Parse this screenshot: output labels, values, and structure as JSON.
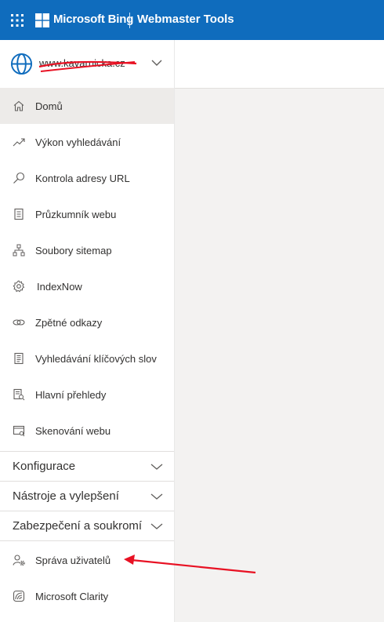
{
  "header": {
    "brand": "Microsoft Bing",
    "product": "Webmaster Tools"
  },
  "site": {
    "url": "www.kavarnicka.cz"
  },
  "nav": {
    "items": [
      {
        "label": "Domů",
        "icon": "home-icon"
      },
      {
        "label": "Výkon vyhledávání",
        "icon": "trend-icon"
      },
      {
        "label": "Kontrola adresy URL",
        "icon": "search-icon"
      },
      {
        "label": "Průzkumník webu",
        "icon": "document-icon"
      },
      {
        "label": "Soubory sitemap",
        "icon": "sitemap-icon"
      },
      {
        "label": "IndexNow",
        "icon": "gear-icon"
      },
      {
        "label": "Zpětné odkazy",
        "icon": "link-icon"
      },
      {
        "label": "Vyhledávání klíčových slov",
        "icon": "list-icon"
      },
      {
        "label": "Hlavní přehledy",
        "icon": "report-icon"
      },
      {
        "label": "Skenování webu",
        "icon": "scan-icon"
      }
    ],
    "sections": [
      {
        "label": "Konfigurace"
      },
      {
        "label": "Nástroje a vylepšení"
      },
      {
        "label": "Zabezpečení a soukromí"
      }
    ],
    "bottom": [
      {
        "label": "Správa uživatelů",
        "icon": "user-settings-icon"
      },
      {
        "label": "Microsoft Clarity",
        "icon": "clarity-icon"
      }
    ]
  },
  "colors": {
    "header_bg": "#0f6cbd",
    "active_bg": "#edebe9",
    "annotation": "#e81123"
  }
}
